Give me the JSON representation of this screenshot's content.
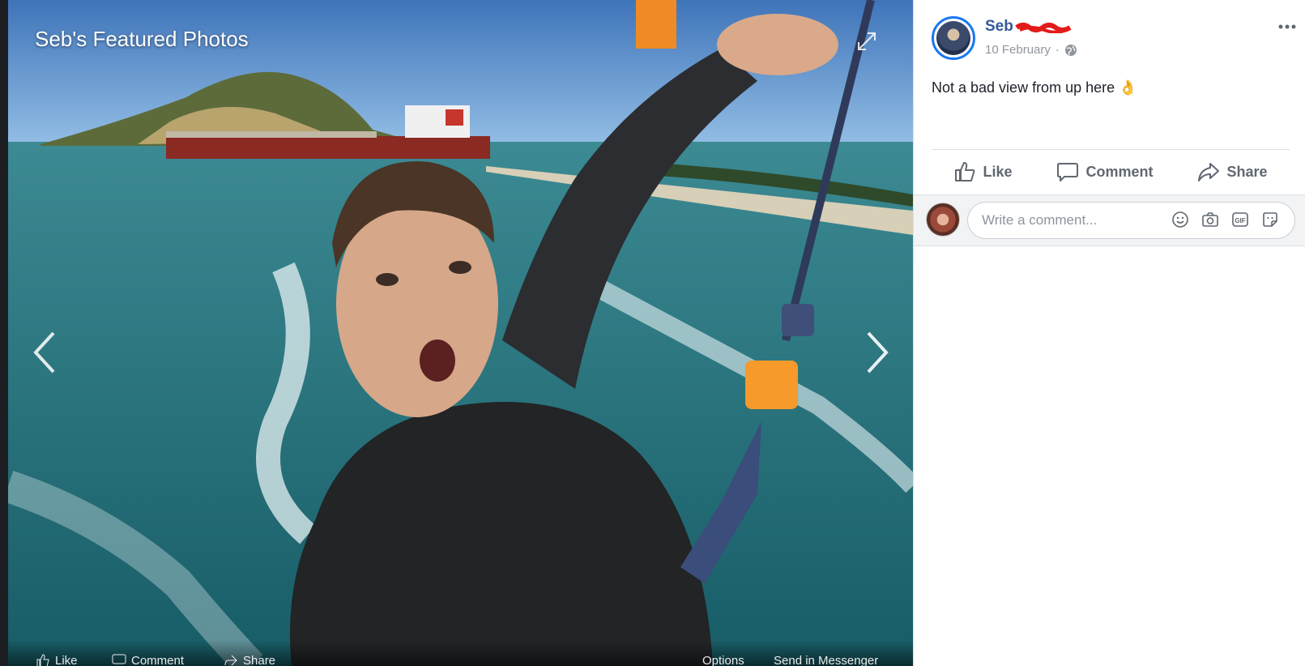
{
  "viewer": {
    "title": "Seb's Featured Photos",
    "bottom_bar": {
      "like": "Like",
      "comment": "Comment",
      "share": "Share",
      "options": "Options",
      "send_messenger": "Send in Messenger"
    }
  },
  "post": {
    "author": "Seb",
    "date": "10 February",
    "privacy_icon": "globe-icon",
    "text": "Not a bad view from up here 👌"
  },
  "actions": {
    "like": "Like",
    "comment": "Comment",
    "share": "Share"
  },
  "comment_box": {
    "placeholder": "Write a comment...",
    "icons": [
      "emoji-icon",
      "camera-icon",
      "gif-icon",
      "sticker-icon"
    ]
  },
  "colors": {
    "link": "#365899",
    "meta": "#90949c",
    "action": "#606770",
    "accent": "#1877f2"
  }
}
